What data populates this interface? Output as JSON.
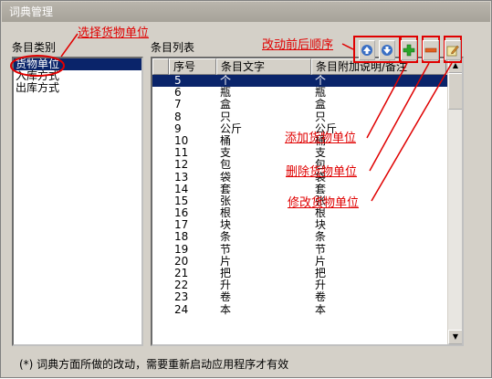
{
  "window": {
    "title": "词典管理"
  },
  "left_panel": {
    "label": "条目类别",
    "items": [
      "货物单位",
      "入库方式",
      "出库方式"
    ],
    "selected_index": 0
  },
  "right_panel": {
    "label": "条目列表",
    "columns": [
      "序号",
      "条目文字",
      "条目附加说明/备注"
    ],
    "rows": [
      [
        "5",
        "个",
        "个"
      ],
      [
        "6",
        "瓶",
        "瓶"
      ],
      [
        "7",
        "盒",
        "盒"
      ],
      [
        "8",
        "只",
        "只"
      ],
      [
        "9",
        "公斤",
        "公斤"
      ],
      [
        "10",
        "桶",
        "桶"
      ],
      [
        "11",
        "支",
        "支"
      ],
      [
        "12",
        "包",
        "包"
      ],
      [
        "13",
        "袋",
        "袋"
      ],
      [
        "14",
        "套",
        "套"
      ],
      [
        "15",
        "张",
        "张"
      ],
      [
        "16",
        "根",
        "根"
      ],
      [
        "17",
        "块",
        "块"
      ],
      [
        "18",
        "条",
        "条"
      ],
      [
        "19",
        "节",
        "节"
      ],
      [
        "20",
        "片",
        "片"
      ],
      [
        "21",
        "把",
        "把"
      ],
      [
        "22",
        "升",
        "升"
      ],
      [
        "23",
        "卷",
        "卷"
      ],
      [
        "24",
        "本",
        "本"
      ]
    ],
    "selected_row": 0
  },
  "toolbar": {
    "move_up_icon": "arrow-up-icon",
    "move_down_icon": "arrow-down-icon",
    "add_icon": "plus-icon",
    "delete_icon": "minus-icon",
    "edit_icon": "edit-icon"
  },
  "annotations": {
    "select_unit": "选择货物单位",
    "reorder": "改动前后顺序",
    "add": "添加货物单位",
    "delete": "删除货物单位",
    "edit": "修改货物单位"
  },
  "footer_note": "(*) 词典方面所做的改动，需要重新启动应用程序才有效",
  "colors": {
    "annotation": "#e00000",
    "selection": "#0a246a"
  }
}
